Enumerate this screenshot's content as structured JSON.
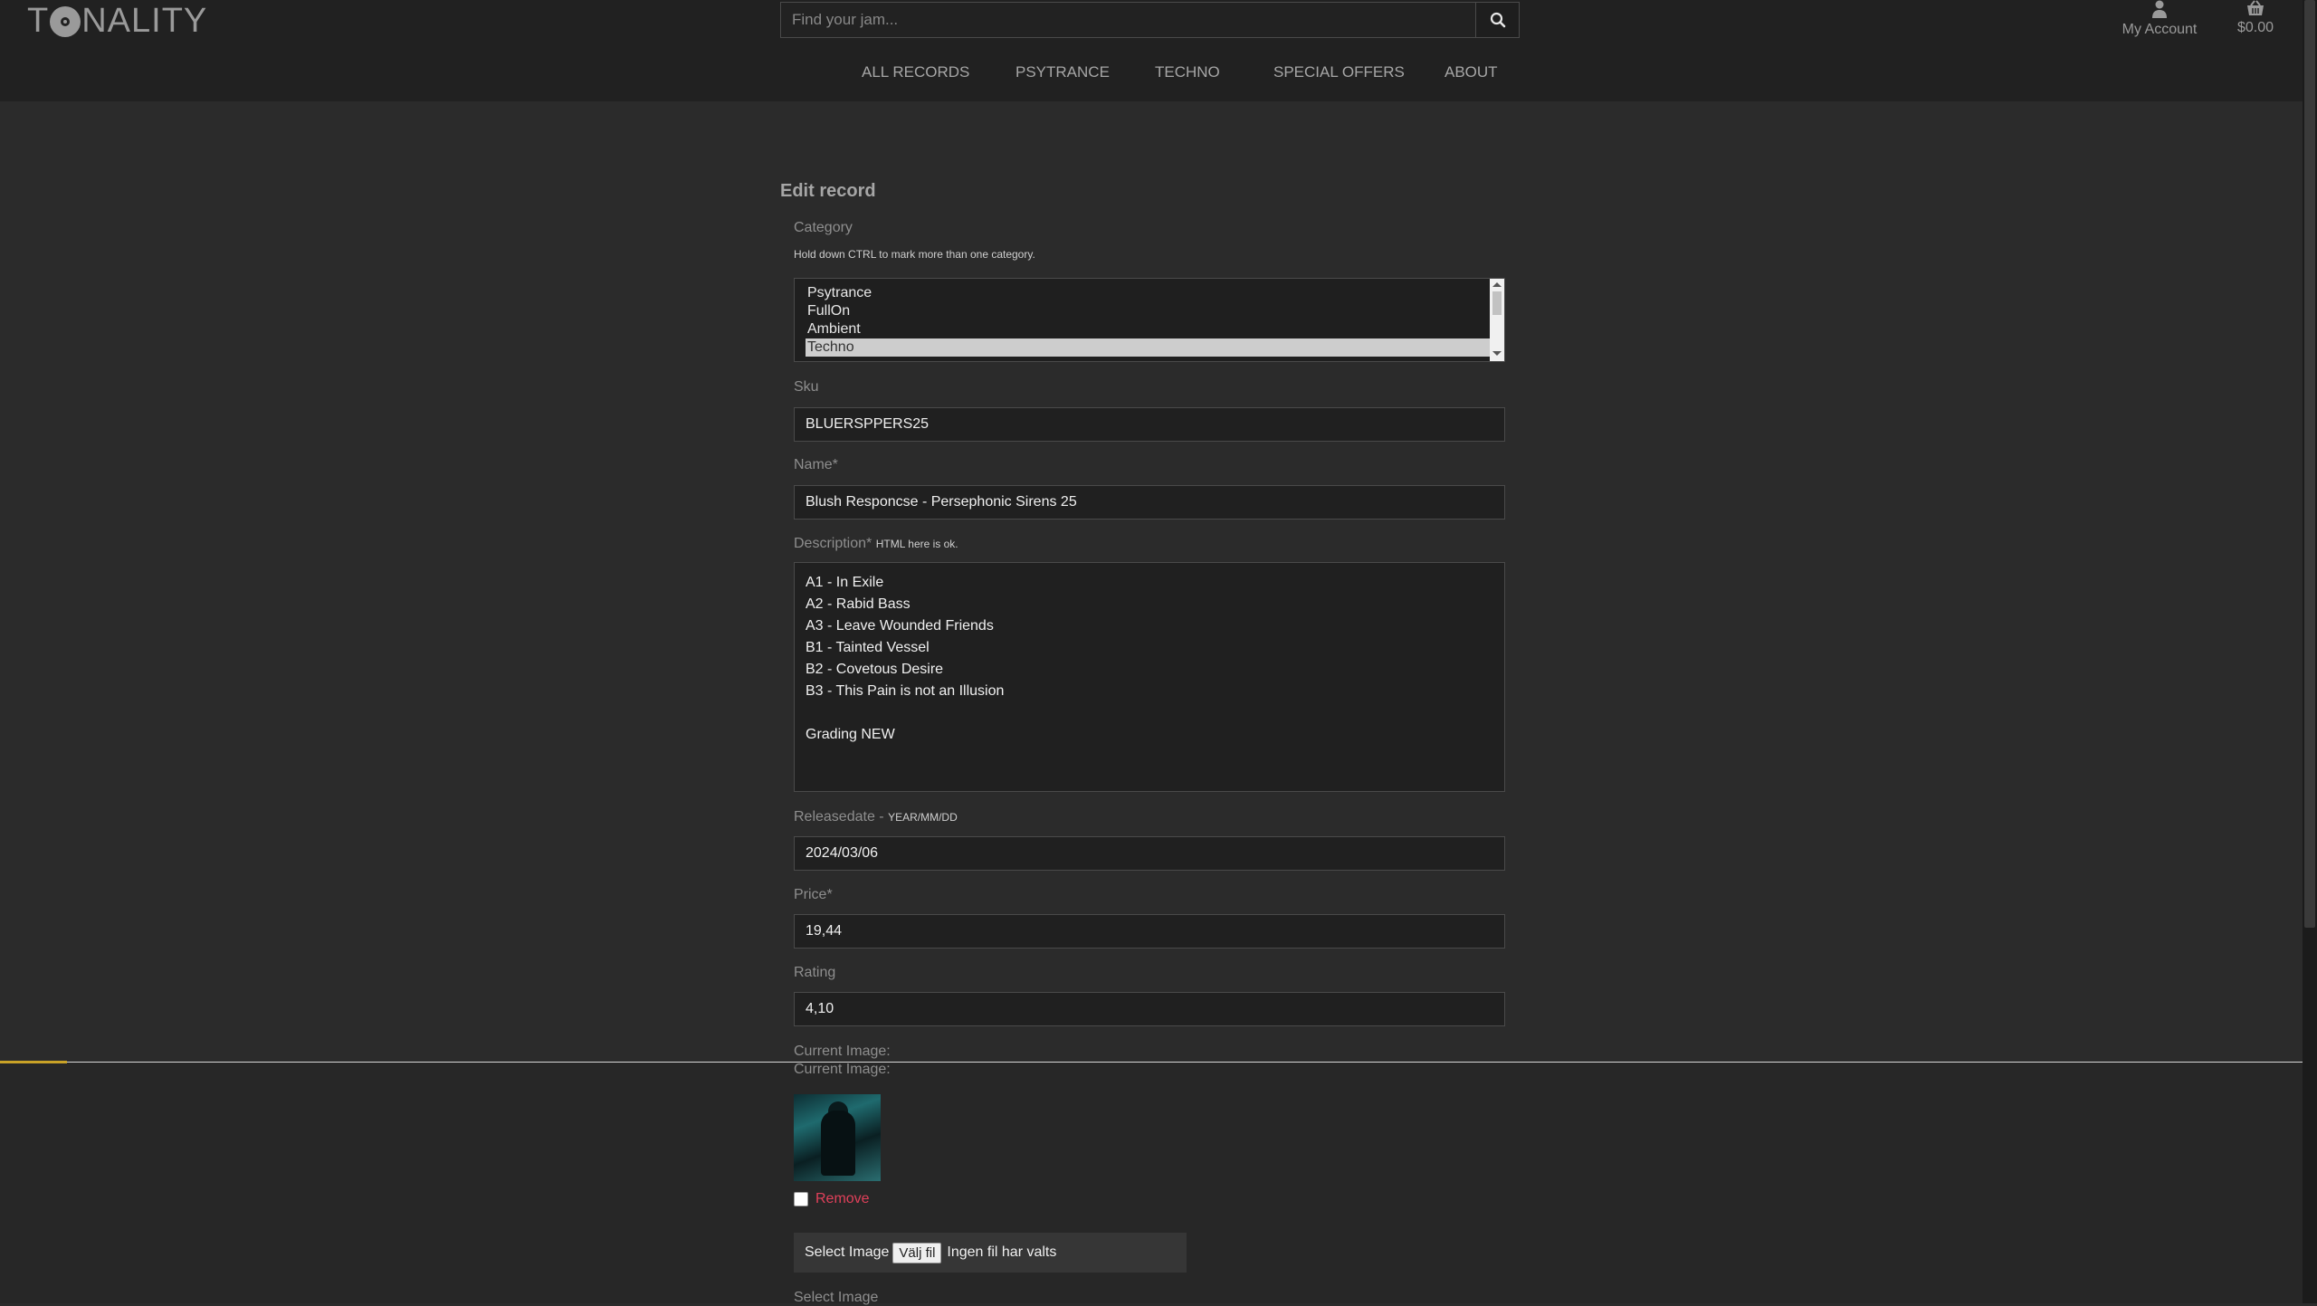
{
  "header": {
    "logo_prefix": "T",
    "logo_suffix": "NALITY",
    "search_placeholder": "Find your jam...",
    "account_label": "My Account",
    "cart_total": "$0.00"
  },
  "nav": [
    "ALL RECORDS",
    "PSYTRANCE",
    "TECHNO",
    "SPECIAL OFFERS",
    "ABOUT"
  ],
  "form": {
    "title": "Edit record",
    "category_label": "Category",
    "category_hint": "Hold down CTRL to mark more than one category.",
    "categories": [
      "Psytrance",
      "FullOn",
      "Ambient",
      "Techno"
    ],
    "selected_category": "Techno",
    "sku_label": "Sku",
    "sku_value": "BLUERSPPERS25",
    "name_label": "Name*",
    "name_value": "Blush Responcse - Persephonic Sirens 25",
    "description_label": "Description*",
    "description_hint": "HTML here is ok.",
    "description_value": "A1 - In Exile\nA2 - Rabid Bass\nA3 - Leave Wounded Friends\nB1 - Tainted Vessel\nB2 - Covetous Desire\nB3 - This Pain is not an Illusion\n\nGrading NEW",
    "releasedate_label": "Releasedate -",
    "releasedate_hint": "YEAR/MM/DD",
    "releasedate_value": "2024/03/06",
    "price_label": "Price*",
    "price_value": "19,44",
    "rating_label": "Rating",
    "rating_value": "4,10",
    "current_image_label": "Current Image:",
    "current_image_label_2": "Current Image:",
    "remove_label": "Remove",
    "select_image_label": "Select Image",
    "file_button": "Välj fil",
    "file_status": "Ingen fil har valts",
    "select_image_label_2": "Select Image"
  },
  "colors": {
    "background": "#2b2b2b",
    "header": "#212121",
    "accent": "#c9a227",
    "remove": "#e0405a"
  }
}
